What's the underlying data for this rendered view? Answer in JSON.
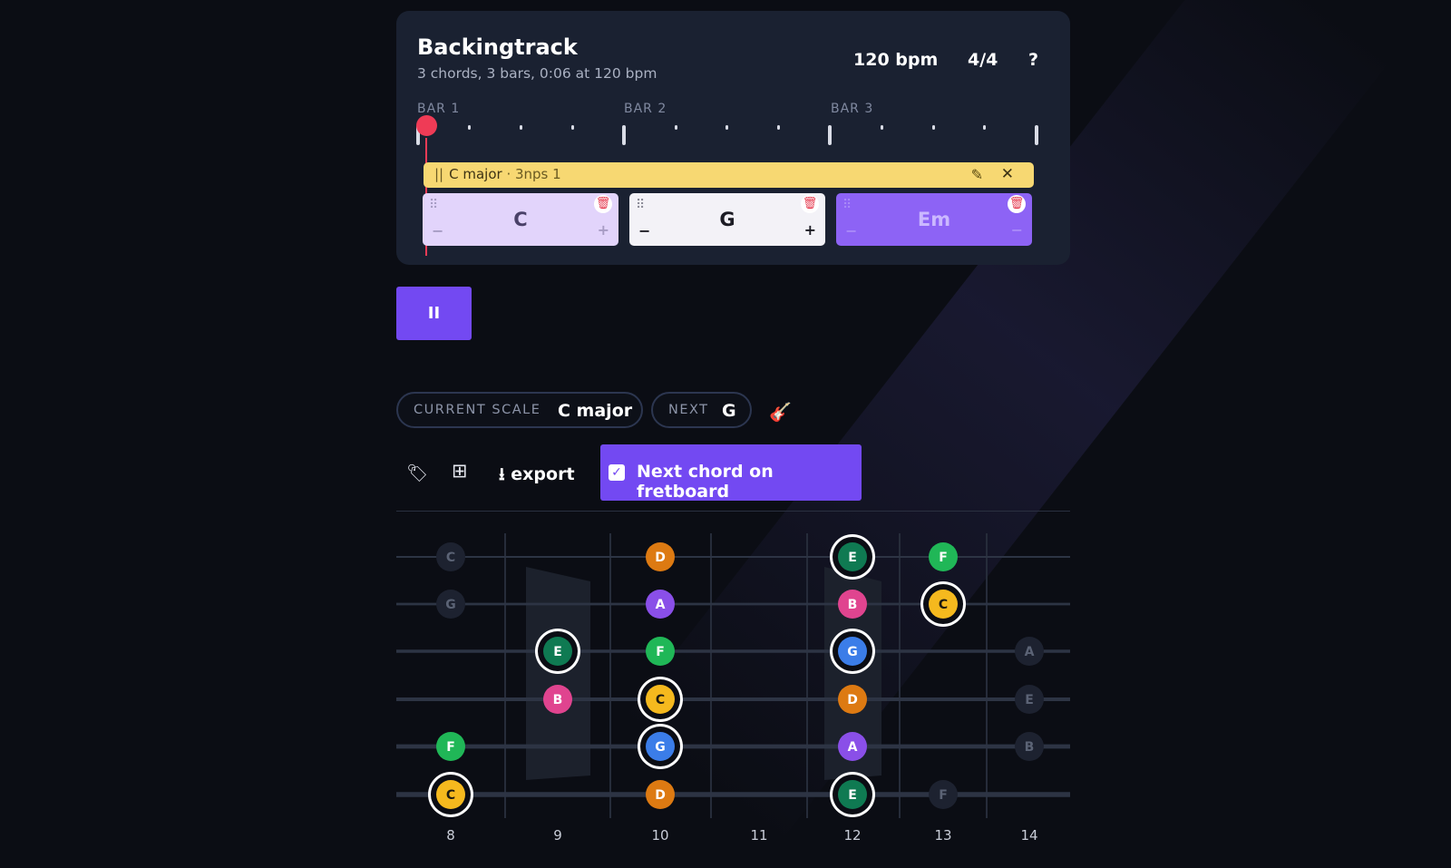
{
  "backingtrack": {
    "title": "Backingtrack",
    "subtitle": "3 chords, 3 bars, 0:06 at 120 bpm",
    "bpm": "120 bpm",
    "time_signature": "4/4",
    "help_label": "?",
    "bars": [
      "BAR 1",
      "BAR 2",
      "BAR 3"
    ],
    "scale_bar": {
      "grip": "||",
      "name": "C major",
      "detail": "· 3nps 1",
      "edit_icon": "pencil-icon",
      "close_icon": "close-icon",
      "color": "#f7d872"
    },
    "chords": [
      {
        "name": "C",
        "state": "active",
        "color": "#e2d4fb"
      },
      {
        "name": "G",
        "state": "next",
        "color": "#f3f2f7"
      },
      {
        "name": "Em",
        "state": "upcoming",
        "color": "#8d63f5"
      }
    ]
  },
  "transport": {
    "pause_label": "II",
    "accent_color": "#7349f2"
  },
  "scale_info": {
    "current_key": "CURRENT SCALE",
    "current_value": "C major",
    "next_key": "NEXT",
    "next_value": "G",
    "guitar_icon": "guitar-icon"
  },
  "toolbar": {
    "tags_icon": "tags-icon",
    "grid_icon": "grid-icon",
    "export_label": "export",
    "export_icon": "download-icon",
    "next_chord_label": "Next chord on fretboard",
    "next_chord_checked": true
  },
  "fretboard": {
    "frets": [
      "8",
      "9",
      "10",
      "11",
      "12",
      "13",
      "14"
    ],
    "note_colors": {
      "C": "#f5b91e",
      "D": "#dd7a12",
      "E": "#0f7a52",
      "F": "#20b757",
      "G": "#3b7de8",
      "A": "#8a4fe8",
      "B": "#e0448f"
    },
    "notes": [
      {
        "string": 1,
        "fret": 8,
        "note": "C",
        "style": "dim"
      },
      {
        "string": 1,
        "fret": 10,
        "note": "D",
        "style": "scale"
      },
      {
        "string": 1,
        "fret": 12,
        "note": "E",
        "style": "chord"
      },
      {
        "string": 1,
        "fret": 13,
        "note": "F",
        "style": "scale"
      },
      {
        "string": 2,
        "fret": 8,
        "note": "G",
        "style": "dim"
      },
      {
        "string": 2,
        "fret": 10,
        "note": "A",
        "style": "scale"
      },
      {
        "string": 2,
        "fret": 12,
        "note": "B",
        "style": "scale"
      },
      {
        "string": 2,
        "fret": 13,
        "note": "C",
        "style": "chord"
      },
      {
        "string": 3,
        "fret": 9,
        "note": "E",
        "style": "chord"
      },
      {
        "string": 3,
        "fret": 10,
        "note": "F",
        "style": "scale"
      },
      {
        "string": 3,
        "fret": 12,
        "note": "G",
        "style": "chord"
      },
      {
        "string": 3,
        "fret": 14,
        "note": "A",
        "style": "dim"
      },
      {
        "string": 4,
        "fret": 9,
        "note": "B",
        "style": "scale"
      },
      {
        "string": 4,
        "fret": 10,
        "note": "C",
        "style": "chord"
      },
      {
        "string": 4,
        "fret": 12,
        "note": "D",
        "style": "scale"
      },
      {
        "string": 4,
        "fret": 14,
        "note": "E",
        "style": "dim"
      },
      {
        "string": 5,
        "fret": 8,
        "note": "F",
        "style": "scale"
      },
      {
        "string": 5,
        "fret": 10,
        "note": "G",
        "style": "chord"
      },
      {
        "string": 5,
        "fret": 12,
        "note": "A",
        "style": "scale"
      },
      {
        "string": 5,
        "fret": 14,
        "note": "B",
        "style": "dim"
      },
      {
        "string": 6,
        "fret": 8,
        "note": "C",
        "style": "chord"
      },
      {
        "string": 6,
        "fret": 10,
        "note": "D",
        "style": "scale"
      },
      {
        "string": 6,
        "fret": 12,
        "note": "E",
        "style": "chord"
      },
      {
        "string": 6,
        "fret": 13,
        "note": "F",
        "style": "dim"
      }
    ]
  }
}
